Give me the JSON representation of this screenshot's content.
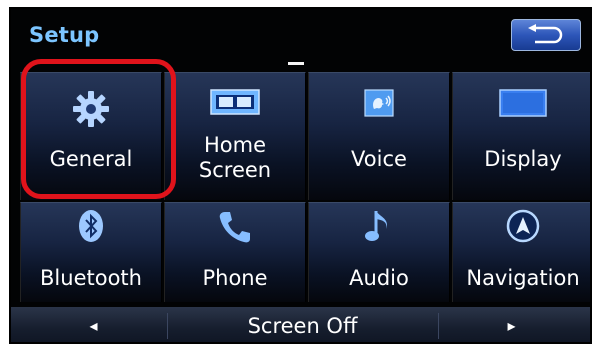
{
  "header": {
    "title": "Setup",
    "back_icon": "return-arrow-icon"
  },
  "menu": [
    {
      "id": "general",
      "label": "General",
      "icon": "gear-icon"
    },
    {
      "id": "home-screen",
      "label_line1": "Home",
      "label_line2": "Screen",
      "icon": "home-screen-layout-icon"
    },
    {
      "id": "voice",
      "label": "Voice",
      "icon": "voice-icon"
    },
    {
      "id": "display",
      "label": "Display",
      "icon": "display-icon"
    },
    {
      "id": "bluetooth",
      "label": "Bluetooth",
      "icon": "bluetooth-icon"
    },
    {
      "id": "phone",
      "label": "Phone",
      "icon": "phone-icon"
    },
    {
      "id": "audio",
      "label": "Audio",
      "icon": "music-note-icon"
    },
    {
      "id": "navigation",
      "label": "Navigation",
      "icon": "navigation-icon"
    }
  ],
  "bottom_bar": {
    "prev_symbol": "◂",
    "screen_off_label": "Screen Off",
    "next_symbol": "▸"
  },
  "colors": {
    "title": "#7cc5ff",
    "highlight": "#e0131b",
    "back_button": "#2d56b9"
  }
}
